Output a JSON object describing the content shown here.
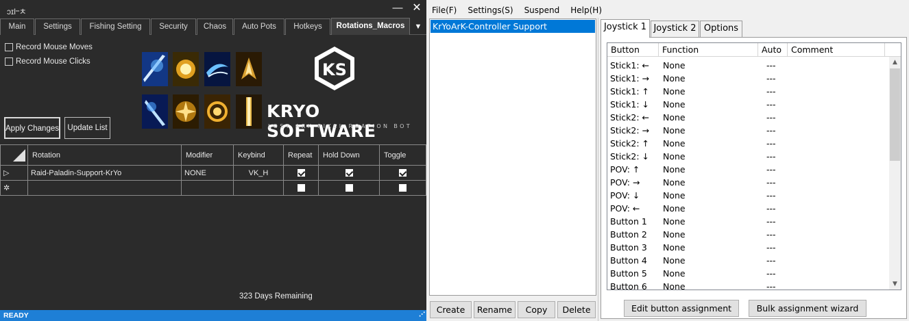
{
  "left_window": {
    "title": "ɔɪl᠆ㅊ",
    "minimize_glyph": "—",
    "close_glyph": "✕",
    "tabs": [
      {
        "label": "Main"
      },
      {
        "label": "Settings"
      },
      {
        "label": "Fishing Setting"
      },
      {
        "label": "Security"
      },
      {
        "label": "Chaos"
      },
      {
        "label": "Auto Pots"
      },
      {
        "label": "Hotkeys"
      },
      {
        "label": "Rotations_Macros"
      }
    ],
    "tab_more_glyph": "▼",
    "options": {
      "record_mouse_moves": "Record Mouse Moves",
      "record_mouse_clicks": "Record Mouse Clicks"
    },
    "buttons": {
      "apply": "Apply Changes",
      "update": "Update List"
    },
    "logo": {
      "text": "KRYO SOFTWARE",
      "subtitle": "LOST ARK PIXEL ROATION BOT"
    },
    "grid": {
      "columns": [
        "Rotation",
        "Modifier",
        "Keybind",
        "Repeat",
        "Hold Down",
        "Toggle"
      ],
      "rows": [
        {
          "marker": "▷",
          "rotation": "Raid-Paladin-Support-KrYo",
          "modifier": "NONE",
          "keybind": "VK_H",
          "repeat": true,
          "hold_down": true,
          "toggle": true
        },
        {
          "marker": "✲",
          "rotation": "",
          "modifier": "",
          "keybind": "",
          "repeat": false,
          "hold_down": false,
          "toggle": false
        }
      ]
    },
    "days_remaining": "323 Days Remaining",
    "status": "READY",
    "accent_color": "#1e7fd6"
  },
  "right_window": {
    "menu": [
      "File(F)",
      "Settings(S)",
      "Suspend",
      "Help(H)"
    ],
    "profiles": [
      "KrYoArK-Controller Support"
    ],
    "profile_buttons": {
      "create": "Create",
      "rename": "Rename",
      "copy": "Copy",
      "delete": "Delete"
    },
    "tabs": [
      "Joystick 1",
      "Joystick 2",
      "Options"
    ],
    "list_columns": [
      "Button",
      "Function",
      "Auto",
      "Comment"
    ],
    "assignments": [
      {
        "button": "Stick1: ←",
        "function": "None",
        "auto": "---",
        "comment": ""
      },
      {
        "button": "Stick1: →",
        "function": "None",
        "auto": "---",
        "comment": ""
      },
      {
        "button": "Stick1: ↑",
        "function": "None",
        "auto": "---",
        "comment": ""
      },
      {
        "button": "Stick1: ↓",
        "function": "None",
        "auto": "---",
        "comment": ""
      },
      {
        "button": "Stick2: ←",
        "function": "None",
        "auto": "---",
        "comment": ""
      },
      {
        "button": "Stick2: →",
        "function": "None",
        "auto": "---",
        "comment": ""
      },
      {
        "button": "Stick2: ↑",
        "function": "None",
        "auto": "---",
        "comment": ""
      },
      {
        "button": "Stick2: ↓",
        "function": "None",
        "auto": "---",
        "comment": ""
      },
      {
        "button": "POV: ↑",
        "function": "None",
        "auto": "---",
        "comment": ""
      },
      {
        "button": "POV: →",
        "function": "None",
        "auto": "---",
        "comment": ""
      },
      {
        "button": "POV: ↓",
        "function": "None",
        "auto": "---",
        "comment": ""
      },
      {
        "button": "POV: ←",
        "function": "None",
        "auto": "---",
        "comment": ""
      },
      {
        "button": "Button 1",
        "function": "None",
        "auto": "---",
        "comment": ""
      },
      {
        "button": "Button 2",
        "function": "None",
        "auto": "---",
        "comment": ""
      },
      {
        "button": "Button 3",
        "function": "None",
        "auto": "---",
        "comment": ""
      },
      {
        "button": "Button 4",
        "function": "None",
        "auto": "---",
        "comment": ""
      },
      {
        "button": "Button 5",
        "function": "None",
        "auto": "---",
        "comment": ""
      },
      {
        "button": "Button 6",
        "function": "None",
        "auto": "---",
        "comment": ""
      }
    ],
    "panel_buttons": {
      "edit": "Edit button assignment",
      "wizard": "Bulk assignment wizard"
    },
    "scroll_up_glyph": "▲",
    "scroll_down_glyph": "▼",
    "selection_color": "#0078d7"
  }
}
